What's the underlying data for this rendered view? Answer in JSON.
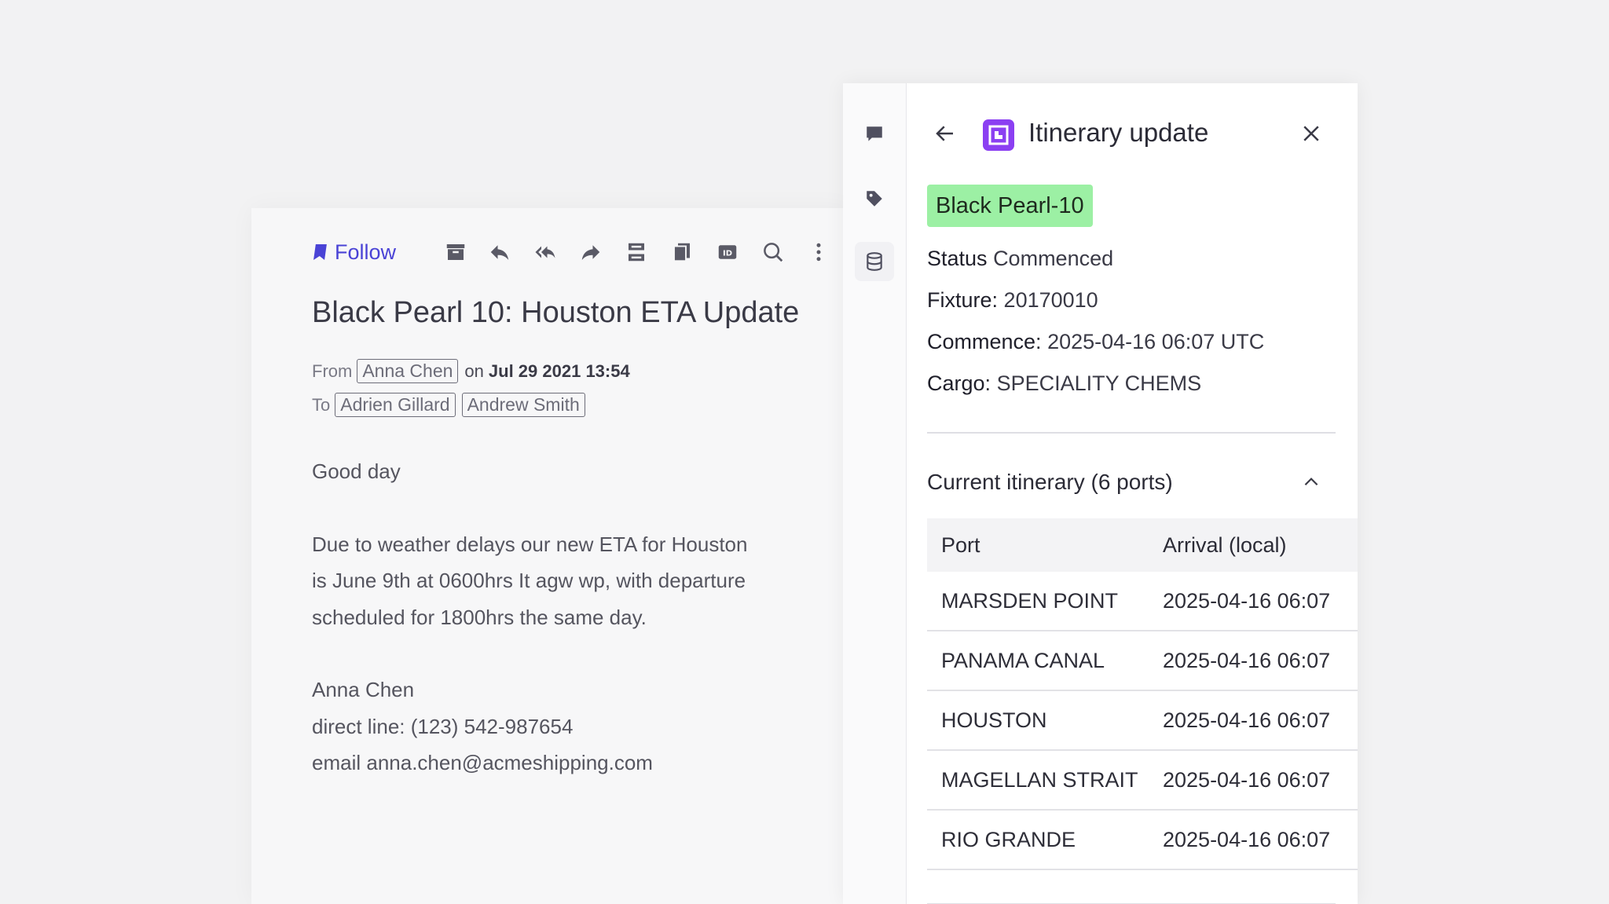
{
  "email": {
    "toolbar": {
      "follow_label": "Follow",
      "icons": [
        "archive-icon",
        "reply-icon",
        "reply-all-icon",
        "forward-icon",
        "split-icon",
        "copy-icon",
        "id-icon",
        "search-icon",
        "more-icon"
      ],
      "accent_color": "#4a43d6"
    },
    "subject": "Black Pearl 10: Houston ETA Update",
    "from_label": "From",
    "from": "Anna Chen",
    "on_label": "on",
    "date": "Jul 29 2021 13:54",
    "to_label": "To",
    "to": [
      "Adrien Gillard",
      "Andrew Smith"
    ],
    "body": {
      "greeting": "Good day",
      "para_lines": [
        "Due to weather delays our new ETA for Houston",
        "is June 9th at 0600hrs It agw wp, with departure",
        "scheduled for 1800hrs the same day."
      ],
      "signature": [
        "Anna Chen",
        "direct line: (123) 542-987654",
        "email anna.chen@acmeshipping.com"
      ]
    }
  },
  "side_panel": {
    "rail_icons": [
      "comment-icon",
      "tag-icon",
      "database-icon"
    ],
    "title": "Itinerary update",
    "logo_color": "#8b3ff2",
    "vessel": "Black Pearl-10",
    "vessel_tag_color": "#9cf0a4",
    "fields": [
      {
        "key": "Status",
        "value": "Commenced"
      },
      {
        "key": "Fixture:",
        "value": "20170010"
      },
      {
        "key": "Commence:",
        "value": "2025-04-16 06:07 UTC"
      },
      {
        "key": "Cargo:",
        "value": "SPECIALITY CHEMS"
      }
    ],
    "itinerary": {
      "title": "Current itinerary (6 ports)",
      "columns": [
        "Port",
        "Arrival (local)"
      ],
      "rows": [
        {
          "port": "MARSDEN POINT",
          "arrival": "2025-04-16 06:07"
        },
        {
          "port": "PANAMA CANAL",
          "arrival": "2025-04-16 06:07"
        },
        {
          "port": "HOUSTON",
          "arrival": "2025-04-16 06:07"
        },
        {
          "port": "MAGELLAN STRAIT",
          "arrival": "2025-04-16 06:07"
        },
        {
          "port": "RIO GRANDE",
          "arrival": "2025-04-16 06:07"
        }
      ]
    }
  }
}
